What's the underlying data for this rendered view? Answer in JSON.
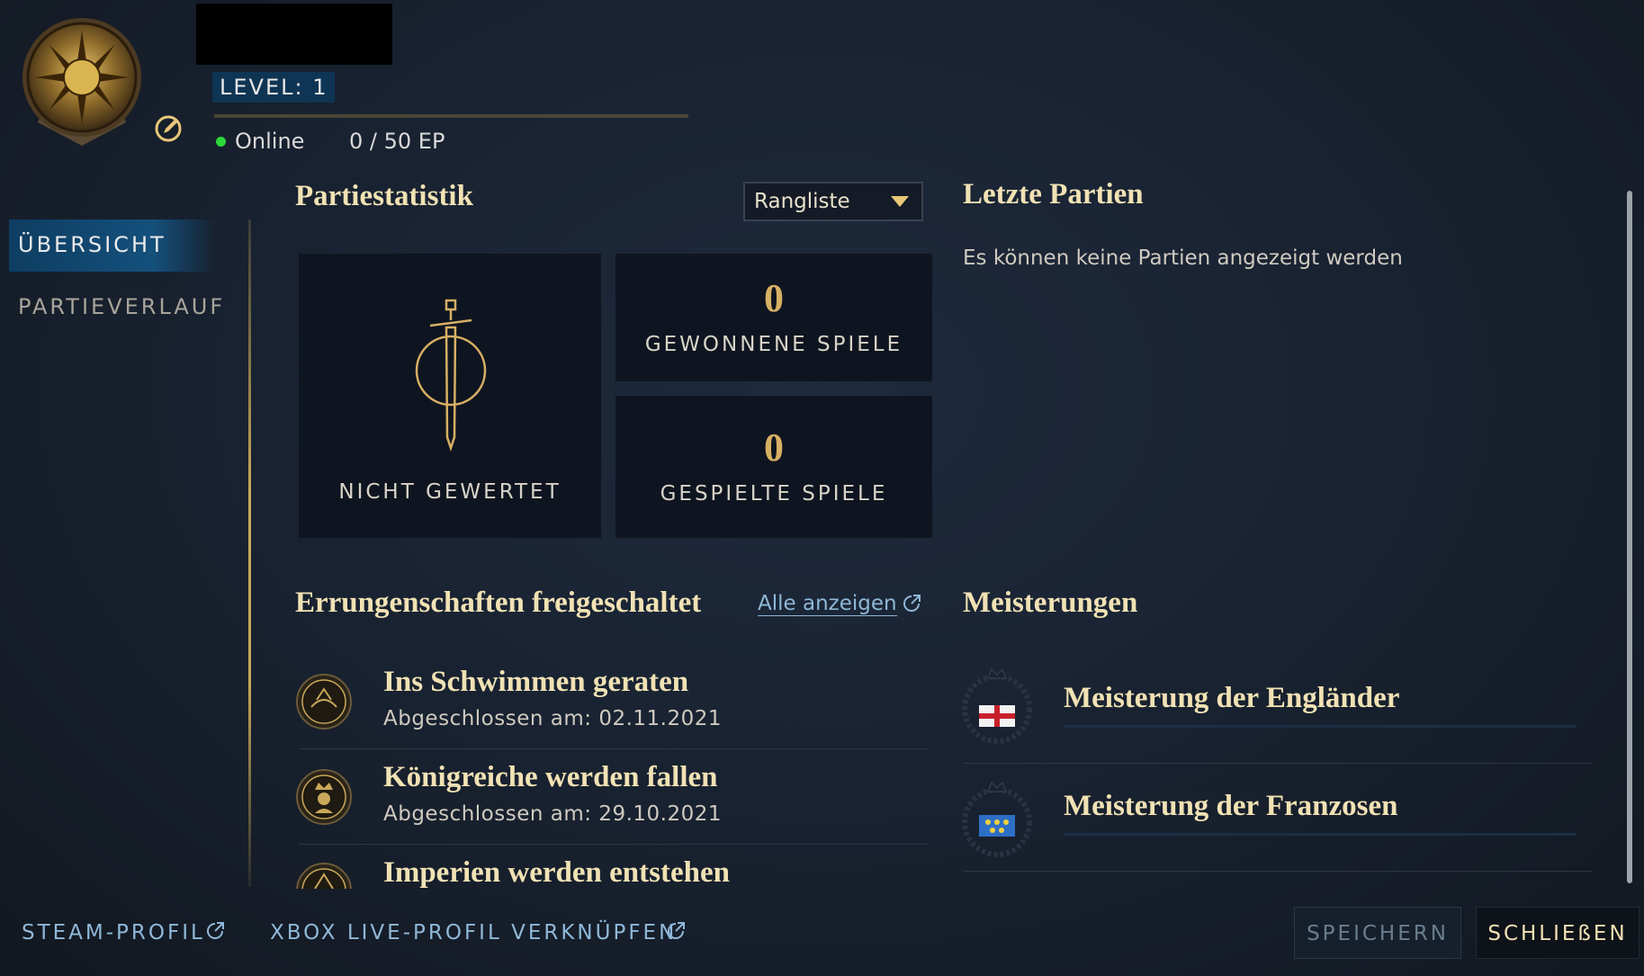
{
  "header": {
    "level_label": "LEVEL: 1",
    "status": "Online",
    "xp": "0 / 50 EP",
    "xp_progress": 0
  },
  "sidebar": {
    "items": [
      {
        "label": "ÜBERSICHT",
        "active": true
      },
      {
        "label": "PARTIEVERLAUF",
        "active": false
      }
    ]
  },
  "stats": {
    "title": "Partiestatistik",
    "dropdown_value": "Rangliste",
    "rank_label": "NICHT GEWERTET",
    "won_value": "0",
    "won_label": "GEWONNENE SPIELE",
    "played_value": "0",
    "played_label": "GESPIELTE SPIELE"
  },
  "recent": {
    "title": "Letzte Partien",
    "empty_text": "Es können keine Partien angezeigt werden"
  },
  "achievements": {
    "title": "Errungenschaften freigeschaltet",
    "show_all": "Alle anzeigen",
    "items": [
      {
        "title": "Ins Schwimmen geraten",
        "date": "Abgeschlossen am: 02.11.2021"
      },
      {
        "title": "Königreiche werden fallen",
        "date": "Abgeschlossen am: 29.10.2021"
      },
      {
        "title": "Imperien werden entstehen",
        "date": ""
      }
    ]
  },
  "masteries": {
    "title": "Meisterungen",
    "items": [
      {
        "title": "Meisterung der Engländer",
        "flag": "england-flag"
      },
      {
        "title": "Meisterung der Franzosen",
        "flag": "france-flag"
      }
    ]
  },
  "footer": {
    "steam_profile": "STEAM-PROFIL",
    "xbox_link": "XBOX LIVE-PROFIL VERKNÜPFEN",
    "save": "SPEICHERN",
    "close": "SCHLIEßEN"
  },
  "colors": {
    "accent_gold": "#f1e2b4",
    "link_blue": "#8fb8d8",
    "online_green": "#2bd93a"
  }
}
